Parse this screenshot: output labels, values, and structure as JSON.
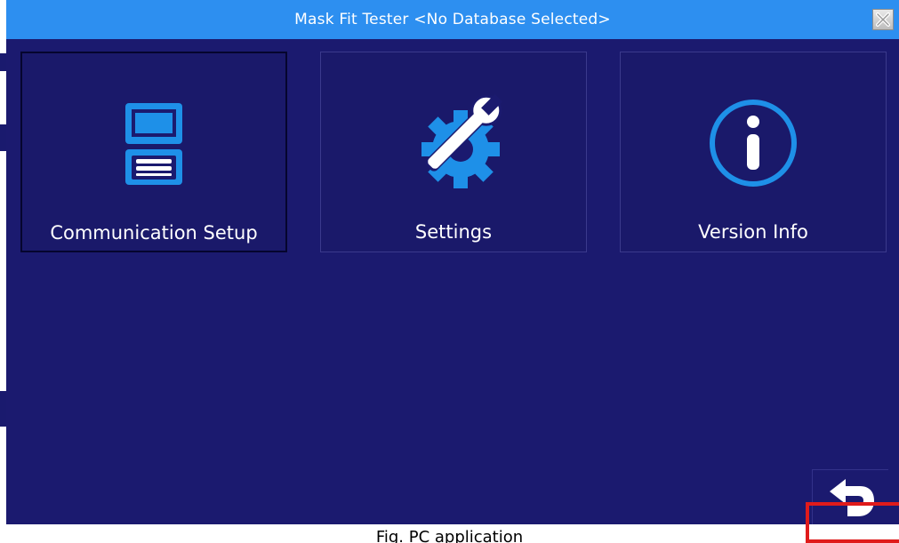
{
  "window": {
    "title": "Mask Fit Tester <No Database Selected>",
    "background_color": "#1b1a6f",
    "titlebar_color": "#2d8ff0",
    "close_icon": "close-x-icon"
  },
  "tiles": [
    {
      "label": "Communication Setup",
      "icon": "communication-device-icon",
      "selected": true
    },
    {
      "label": "Settings",
      "icon": "wrench-gear-icon",
      "selected": false
    },
    {
      "label": "Version Info",
      "icon": "info-circle-icon",
      "selected": false
    }
  ],
  "back_button": {
    "icon": "back-arrow-icon"
  },
  "accent_colors": {
    "icon_blue": "#1e90e8",
    "highlight_red": "#e01b1b"
  },
  "caption": "Fig. PC application"
}
